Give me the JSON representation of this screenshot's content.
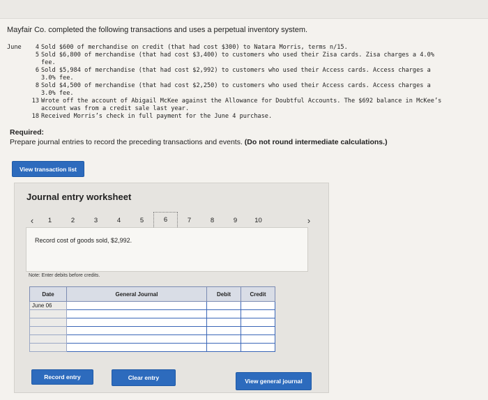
{
  "intro": "Mayfair Co. completed the following transactions and uses a perpetual inventory system.",
  "month": "June",
  "transactions": [
    {
      "day": "4",
      "lines": [
        "Sold $600 of merchandise on credit (that had cost $300) to Natara Morris, terms n/15."
      ]
    },
    {
      "day": "5",
      "lines": [
        "Sold $6,800 of merchandise (that had cost $3,400) to customers who used their Zisa cards. Zisa charges a 4.0%",
        "fee."
      ]
    },
    {
      "day": "6",
      "lines": [
        "Sold $5,984 of merchandise (that had cost $2,992) to customers who used their Access cards. Access charges a",
        "3.0% fee."
      ]
    },
    {
      "day": "8",
      "lines": [
        "Sold $4,500 of merchandise (that had cost $2,250) to customers who used their Access cards. Access charges a",
        "3.0% fee."
      ]
    },
    {
      "day": "13",
      "lines": [
        "Wrote off the account of Abigail McKee against the Allowance for Doubtful Accounts. The $692 balance in McKee’s",
        "account was from a credit sale last year."
      ]
    },
    {
      "day": "18",
      "lines": [
        "Received Morris’s check in full payment for the June 4 purchase."
      ]
    }
  ],
  "required": {
    "heading": "Required:",
    "text": "Prepare journal entries to record the preceding transactions and events.",
    "emphasis": "(Do not round intermediate calculations.)"
  },
  "view_transaction_list": "View transaction list",
  "worksheet": {
    "title": "Journal entry worksheet",
    "pages": [
      "1",
      "2",
      "3",
      "4",
      "5",
      "6",
      "7",
      "8",
      "9",
      "10"
    ],
    "current_page": "6",
    "prev_icon": "‹",
    "next_icon": "›",
    "instruction": "Record cost of goods sold, $2,992.",
    "note": "Note: Enter debits before credits.",
    "columns": {
      "date": "Date",
      "journal": "General Journal",
      "debit": "Debit",
      "credit": "Credit"
    },
    "rows": [
      {
        "date": "June 06",
        "account": "",
        "debit": "",
        "credit": ""
      },
      {
        "date": "",
        "account": "",
        "debit": "",
        "credit": ""
      },
      {
        "date": "",
        "account": "",
        "debit": "",
        "credit": ""
      },
      {
        "date": "",
        "account": "",
        "debit": "",
        "credit": ""
      },
      {
        "date": "",
        "account": "",
        "debit": "",
        "credit": ""
      },
      {
        "date": "",
        "account": "",
        "debit": "",
        "credit": ""
      }
    ]
  },
  "buttons": {
    "record_entry": "Record entry",
    "clear_entry": "Clear entry",
    "view_general_journal": "View general journal"
  },
  "colors": {
    "button": "#2d6bbd",
    "table_header": "#d9dde6",
    "table_border": "#7b8bb2"
  }
}
